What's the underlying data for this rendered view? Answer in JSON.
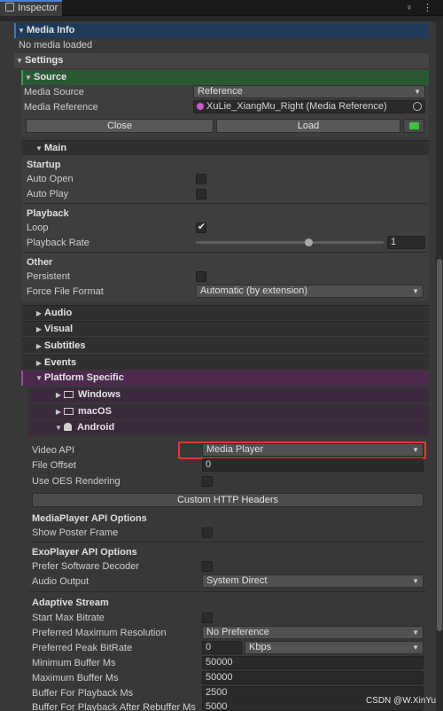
{
  "window": {
    "tab_title": "Inspector",
    "tab_actions": "♀ ⋮"
  },
  "media_info": {
    "header": "Media Info",
    "status": "No media loaded"
  },
  "settings": {
    "header": "Settings"
  },
  "source": {
    "header": "Source",
    "media_source_label": "Media Source",
    "media_source_value": "Reference",
    "media_reference_label": "Media Reference",
    "media_reference_value": "XuLie_XiangMu_Right (Media Reference)",
    "close_label": "Close",
    "load_label": "Load"
  },
  "main": {
    "header": "Main",
    "startup_title": "Startup",
    "auto_open_label": "Auto Open",
    "auto_open": false,
    "auto_play_label": "Auto Play",
    "auto_play": false,
    "playback_title": "Playback",
    "loop_label": "Loop",
    "loop": true,
    "loop_mark": "✔",
    "playback_rate_label": "Playback Rate",
    "playback_rate_value": "1",
    "playback_rate_fraction": 0.6,
    "other_title": "Other",
    "persistent_label": "Persistent",
    "persistent": false,
    "force_format_label": "Force File Format",
    "force_format_value": "Automatic (by extension)"
  },
  "sections": {
    "audio": "Audio",
    "visual": "Visual",
    "subtitles": "Subtitles",
    "events": "Events",
    "platform": "Platform Specific",
    "windows": "Windows",
    "macos": "macOS",
    "android": "Android"
  },
  "android": {
    "video_api_label": "Video API",
    "video_api_value": "Media Player",
    "file_offset_label": "File Offset",
    "file_offset_value": "0",
    "oes_label": "Use OES Rendering",
    "oes": false,
    "http_headers_label": "Custom HTTP Headers",
    "mediaplayer_title": "MediaPlayer API Options",
    "show_poster_label": "Show Poster Frame",
    "show_poster": false,
    "exoplayer_title": "ExoPlayer API Options",
    "prefer_sw_label": "Prefer Software Decoder",
    "prefer_sw": false,
    "audio_output_label": "Audio Output",
    "audio_output_value": "System Direct",
    "adaptive_title": "Adaptive Stream",
    "start_max_label": "Start Max Bitrate",
    "start_max": false,
    "pref_res_label": "Preferred Maximum Resolution",
    "pref_res_value": "No Preference",
    "peak_bitrate_label": "Preferred Peak BitRate",
    "peak_bitrate_value": "0",
    "peak_bitrate_unit": "Kbps",
    "min_buffer_label": "Minimum Buffer Ms",
    "min_buffer_value": "50000",
    "max_buffer_label": "Maximum Buffer Ms",
    "max_buffer_value": "50000",
    "buffer_playback_label": "Buffer For Playback Ms",
    "buffer_playback_value": "2500",
    "buffer_rebuffer_label": "Buffer For Playback After Rebuffer Ms",
    "buffer_rebuffer_value": "5000"
  },
  "watermark": "CSDN @W.XinYu",
  "colors": {
    "accent_blue": "#3a78c4",
    "source_green": "#3fa04f",
    "platform_purple": "#9a4fa0",
    "highlight_red": "#e43a2e"
  }
}
